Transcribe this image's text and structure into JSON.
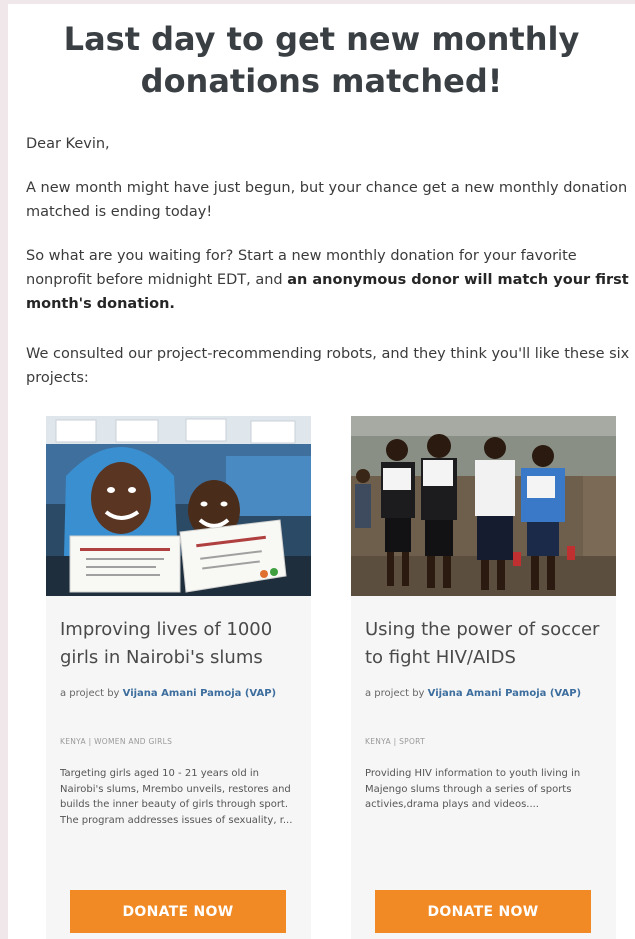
{
  "headline": "Last day to get new monthly donations matched!",
  "greeting": "Dear Kevin,",
  "paragraph_1": "A new month might have just begun, but your chance get a new monthly donation matched is ending today!",
  "paragraph_2_plain": "So what are you waiting for? Start a new monthly donation for your favorite nonprofit before midnight EDT, and ",
  "paragraph_2_bold": "an anonymous donor will match your first month's donation.",
  "paragraph_3": "We consulted our project-recommending robots, and they think you'll like these six projects:",
  "projects": [
    {
      "title": "Improving lives of 1000 girls in Nairobi's slums",
      "byline_prefix": "a project by ",
      "organization": "Vijana Amani Pamoja (VAP)",
      "tags": "KENYA | WOMEN AND GIRLS",
      "description": "Targeting girls aged 10 - 21 years old in Nairobi's slums, Mrembo unveils, restores and builds the inner beauty of girls through sport. The program addresses issues of sexuality, r...",
      "button_label": "DONATE NOW"
    },
    {
      "title": "Using the power of soccer to fight HIV/AIDS",
      "byline_prefix": "a project by ",
      "organization": "Vijana Amani Pamoja (VAP)",
      "tags": "KENYA | SPORT",
      "description": "Providing HIV information to youth living in Majengo slums through a series of sports activies,drama plays and videos....",
      "button_label": "DONATE NOW"
    }
  ],
  "colors": {
    "page_background": "#efe7ea",
    "card_background": "#f6f6f6",
    "button": "#f18a24",
    "organization_link": "#3d6e9e"
  }
}
